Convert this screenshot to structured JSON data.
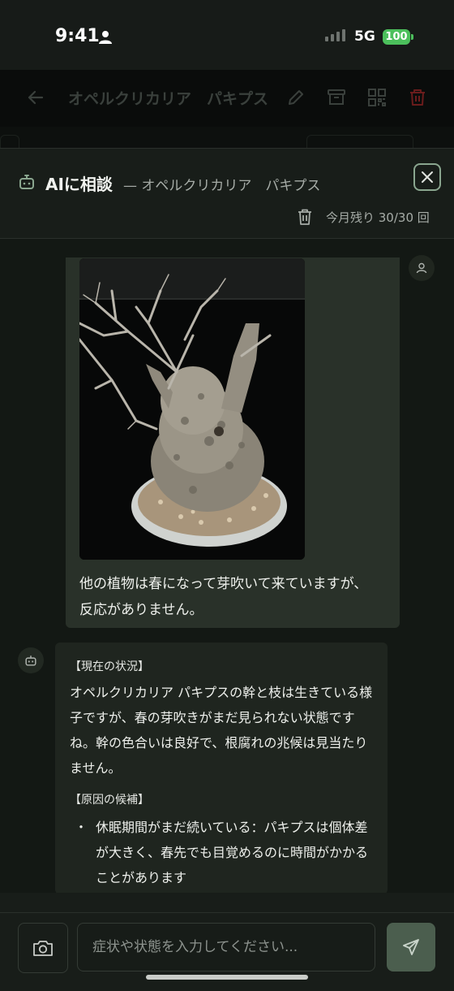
{
  "status_bar": {
    "time": "9:41",
    "network": "5G",
    "battery": "100"
  },
  "background_header": {
    "title": "オペルクリカリア　パキプス"
  },
  "ai_panel": {
    "title": "AIに相談",
    "subtitle": "— オペルクリカリア　パキプス",
    "remaining": "今月残り 30/30 回"
  },
  "messages": {
    "user": {
      "text": "他の植物は春になって芽吹いて来ていますが、反応がありません。"
    },
    "bot": {
      "section_1_title": "【現在の状況】",
      "section_1_text": "オペルクリカリア パキプスの幹と枝は生きている様子ですが、春の芽吹きがまだ見られない状態ですね。幹の色合いは良好で、根腐れの兆候は見当たりません。",
      "section_2_title": "【原因の候補】",
      "bullet_mark": "・",
      "bullet_1": "休眠期間がまだ続いている：パキプスは個体差が大きく、春先でも目覚めるのに時間がかかることがあります"
    }
  },
  "composer": {
    "placeholder": "症状や状態を入力してください..."
  },
  "icons": {
    "header": [
      "back-arrow-icon",
      "edit-icon",
      "archive-icon",
      "qr-code-icon",
      "trash-icon"
    ],
    "panel": [
      "robot-icon",
      "close-icon",
      "trash-icon"
    ],
    "chat": [
      "user-icon",
      "robot-icon"
    ],
    "composer": [
      "camera-icon",
      "send-icon"
    ]
  },
  "colors": {
    "accent": "#8aa68f",
    "send_button": "#4b5e4e",
    "user_bubble": "#293129",
    "bot_bubble": "#1f251f",
    "battery": "#4cc05c",
    "delete_red": "#8b1f1f"
  }
}
